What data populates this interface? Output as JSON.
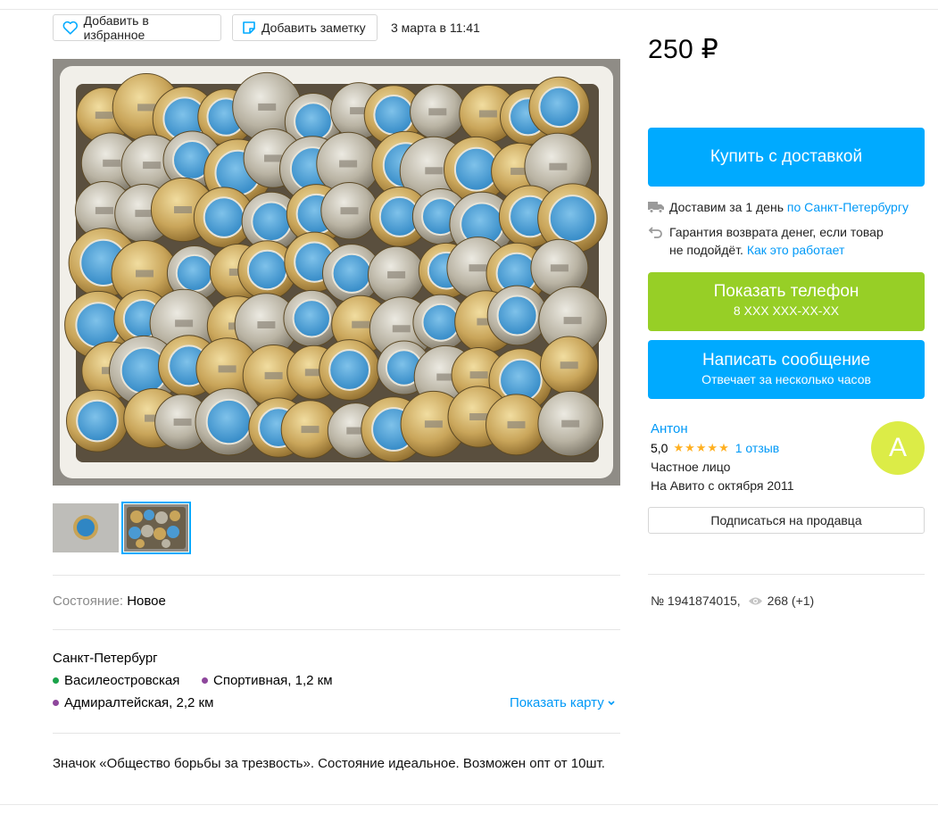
{
  "actions": {
    "favorite_label": "Добавить в избранное",
    "note_label": "Добавить заметку",
    "posted_date": "3 марта в 11:41"
  },
  "listing": {
    "price": "250 ₽",
    "condition_label": "Состояние:",
    "condition_value": "Новое",
    "city": "Санкт-Петербург",
    "metro": [
      {
        "name": "Василеостровская",
        "color": "#1aa34a"
      },
      {
        "name": "Спортивная, 1,2 км",
        "color": "#8e479c"
      },
      {
        "name": "Адмиралтейская, 2,2 км",
        "color": "#8e479c"
      }
    ],
    "show_map": "Показать карту",
    "description": "Значок «Общество борьбы за трезвость». Состояние идеальное. Возможен опт от 10шт."
  },
  "purchase": {
    "buy_label": "Купить с доставкой",
    "delivery_text": "Доставим за 1 день",
    "delivery_link": "по Санкт-Петербургу",
    "guarantee_line1": "Гарантия возврата денег, если товар",
    "guarantee_line2": "не подойдёт.",
    "guarantee_link": "Как это работает",
    "phone_label": "Показать телефон",
    "phone_masked": "8 XXX XXX-XX-XX",
    "message_label": "Написать сообщение",
    "message_sub": "Отвечает за несколько часов"
  },
  "seller": {
    "name": "Антон",
    "rating": "5,0",
    "stars": "★★★★★",
    "reviews": "1 отзыв",
    "type": "Частное лицо",
    "since": "На Авито с октября 2011",
    "avatar_letter": "А",
    "subscribe_label": "Подписаться на продавца"
  },
  "meta": {
    "ad_number": "№ 1941874015,",
    "views": "268 (+1)"
  },
  "colors": {
    "accent_blue": "#00aaff",
    "phone_green": "#97cf26",
    "link_blue": "#0099f7",
    "star_yellow": "#ffb021",
    "avatar": "#dcec47"
  }
}
